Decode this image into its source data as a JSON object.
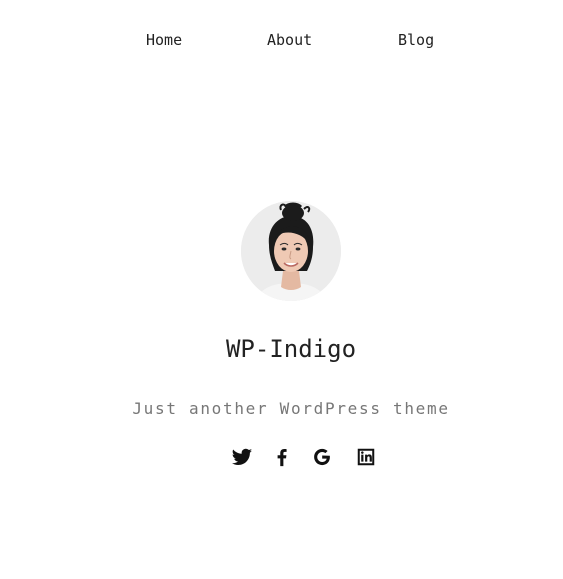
{
  "nav": {
    "items": [
      {
        "label": "Home"
      },
      {
        "label": "About"
      },
      {
        "label": "Blog"
      }
    ]
  },
  "site": {
    "title": "WP-Indigo",
    "tagline": "Just another WordPress theme"
  },
  "social": {
    "icons": [
      "twitter-icon",
      "facebook-icon",
      "google-icon",
      "linkedin-icon"
    ],
    "color": "#111111"
  },
  "colors": {
    "text": "#222222",
    "tagline": "#777777",
    "background": "#ffffff"
  }
}
